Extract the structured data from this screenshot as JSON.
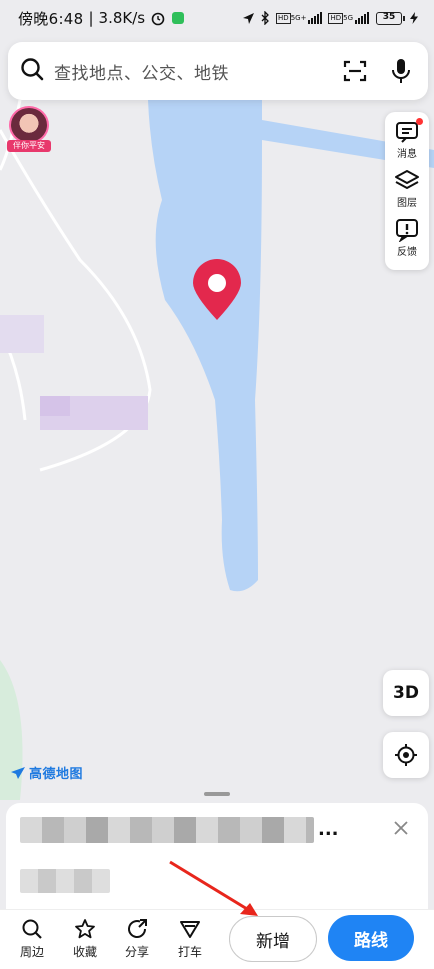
{
  "status_bar": {
    "time": "傍晚6:48",
    "net_speed": "3.8K/s",
    "network_1": "5G+",
    "network_2": "5G",
    "battery": "35"
  },
  "search": {
    "placeholder": "查找地点、公交、地铁",
    "icons": [
      "search-icon",
      "scan-icon",
      "microphone-icon"
    ]
  },
  "avatar": {
    "badge": "伴你平安"
  },
  "tools": {
    "messages_label": "消息",
    "layers_label": "图层",
    "feedback_label": "反馈"
  },
  "map_controls": {
    "three_d_label": "3D"
  },
  "logo": {
    "text": "高德地图"
  },
  "sheet": {
    "title_suffix": "..."
  },
  "bottom_bar": {
    "nearby_label": "周边",
    "favorite_label": "收藏",
    "share_label": "分享",
    "taxi_label": "打车",
    "add_label": "新增",
    "route_label": "路线"
  },
  "colors": {
    "water": "#b6d3f6",
    "map_bg": "#ececef",
    "pin": "#e3284d",
    "accent": "#1f84f4"
  }
}
